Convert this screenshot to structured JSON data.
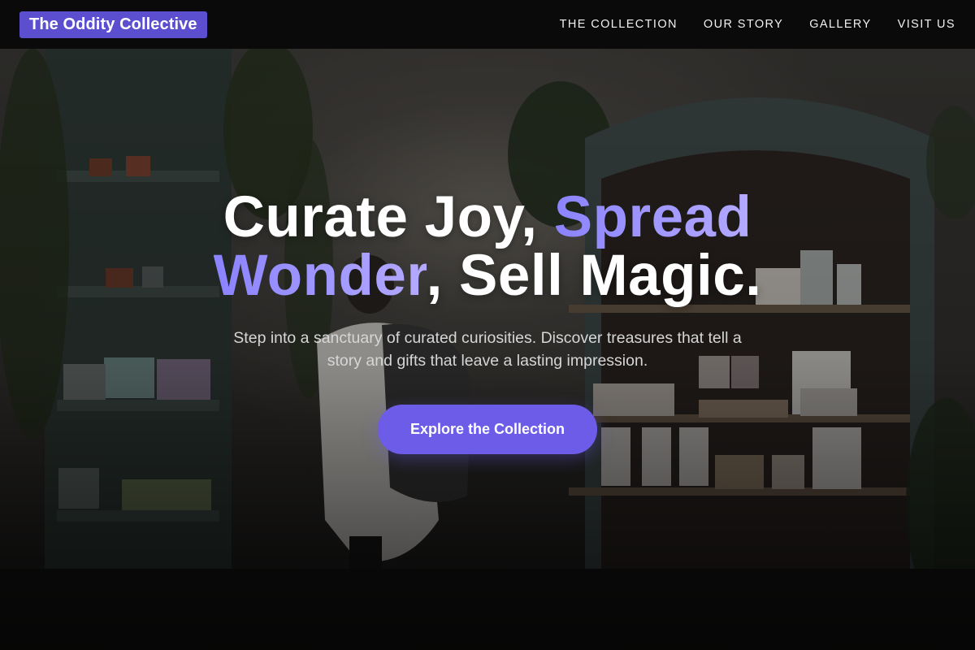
{
  "nav": {
    "brand": "The Oddity Collective",
    "links": [
      "THE COLLECTION",
      "OUR STORY",
      "GALLERY",
      "VISIT US"
    ]
  },
  "hero": {
    "headline_1": "Curate Joy, ",
    "headline_accent_1": "Spread",
    "headline_accent_2": "Wonder",
    "headline_2": ", Sell Magic.",
    "subtitle": "Step into a sanctuary of curated curiosities. Discover treasures that tell a story and gifts that leave a lasting impression.",
    "cta": "Explore the Collection",
    "background_image": "gift-shop-interior-photo"
  },
  "colors": {
    "brand_bg": "#5b4fd0",
    "accent": "#8b83ff",
    "cta_bg": "#6c5ce7"
  }
}
